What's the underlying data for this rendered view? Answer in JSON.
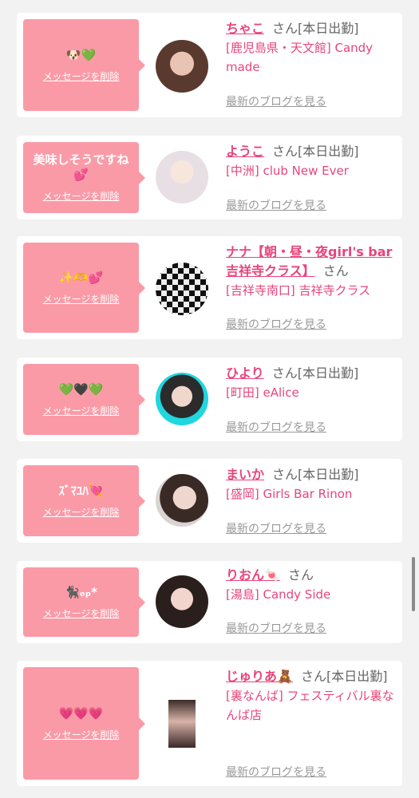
{
  "delete_label": "メッセージを削除",
  "blog_label": "最新のブログを見る",
  "san_label": "さん",
  "cards": [
    {
      "message": "🐶💚",
      "name": "ちゃこ",
      "status": "[本日出勤]",
      "shop": "[鹿児島県・天文館] Candy made"
    },
    {
      "message": "美味しそうですね💕",
      "name": "ようこ",
      "status": "[本日出勤]",
      "shop": "[中洲] club New Ever"
    },
    {
      "message": "✨🫶💕",
      "name": "ナナ【朝・昼・夜girl's bar吉祥寺クラス】",
      "status": "",
      "shop": "[吉祥寺南口] 吉祥寺クラス"
    },
    {
      "message": "💚🖤💚",
      "name": "ひより",
      "status": "[本日出勤]",
      "shop": "[町田] eAlice"
    },
    {
      "message": "ｽﾞﾏﾕﾊ💘",
      "name": "まいか",
      "status": "[本日出勤]",
      "shop": "[盛岡] Girls Bar Rinon"
    },
    {
      "message": "🐈‍⬛ₒₚ*",
      "name": "りおん🍬",
      "status": "",
      "shop": "[湯島] Candy Side"
    },
    {
      "message": "💗💗💗",
      "name": "じゅりあ🧸",
      "status": "[本日出勤]",
      "shop": "[裏なんば] フェスティバル裏なんば店"
    }
  ],
  "colors": {
    "bubble": "#fb9aa7",
    "accent": "#e8457a",
    "background": "#f2f2f2"
  }
}
